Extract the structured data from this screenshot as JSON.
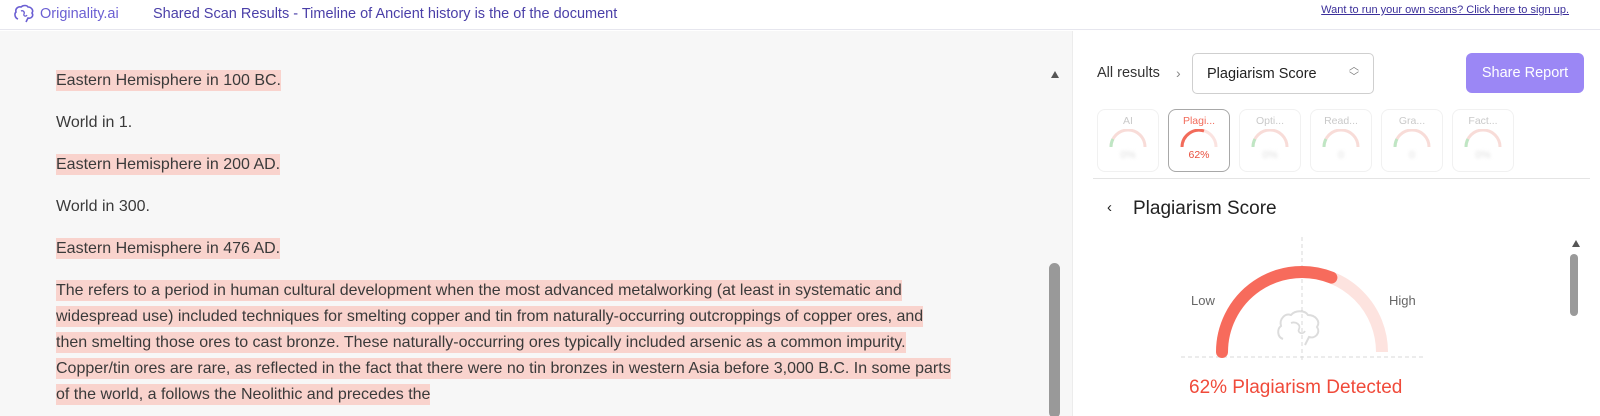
{
  "header": {
    "brand": "Originality.ai",
    "doc_title": "Shared Scan Results - Timeline of Ancient history is the of the document",
    "signup_link": "Want to run your own scans? Click here to sign up."
  },
  "document": {
    "paragraphs": [
      {
        "text": "Eastern Hemisphere in 100 BC.",
        "highlighted": true
      },
      {
        "text": "World in 1.",
        "highlighted": false
      },
      {
        "text": "Eastern Hemisphere in 200 AD.",
        "highlighted": true
      },
      {
        "text": "World in 300.",
        "highlighted": false
      },
      {
        "text": "Eastern Hemisphere in 476 AD.",
        "highlighted": true
      },
      {
        "text": "The refers to a period in human cultural development when the most advanced metalworking (at least in systematic and widespread use) included techniques for smelting copper and tin from naturally-occurring outcroppings of copper ores, and then smelting those ores to cast bronze. These naturally-occurring ores typically included arsenic as a common impurity. Copper/tin ores are rare, as reflected in the fact that there were no tin bronzes in western Asia before 3,000 B.C. In some parts of the world, a follows the Neolithic and precedes the",
        "highlighted": true
      }
    ]
  },
  "panel": {
    "breadcrumb_all": "All results",
    "breadcrumb_chevron": "›",
    "select_value": "Plagiarism Score",
    "share_button": "Share Report",
    "tabs": [
      {
        "label": "AI",
        "value": "0%",
        "active": false
      },
      {
        "label": "Plagi...",
        "value": "62%",
        "active": true
      },
      {
        "label": "Opti...",
        "value": "0%",
        "active": false
      },
      {
        "label": "Read...",
        "value": "0",
        "active": false
      },
      {
        "label": "Gra...",
        "value": "0",
        "active": false
      },
      {
        "label": "Fact...",
        "value": "0%",
        "active": false
      }
    ],
    "section_title": "Plagiarism Score",
    "back_chevron": "‹",
    "gauge": {
      "low_label": "Low",
      "high_label": "High",
      "percent": 62,
      "detected_text": "62% Plagiarism Detected"
    }
  },
  "colors": {
    "brand": "#6b5fd3",
    "highlight": "#f9d3cd",
    "accent_red": "#f04a3a",
    "share_button": "#9b87f5"
  }
}
